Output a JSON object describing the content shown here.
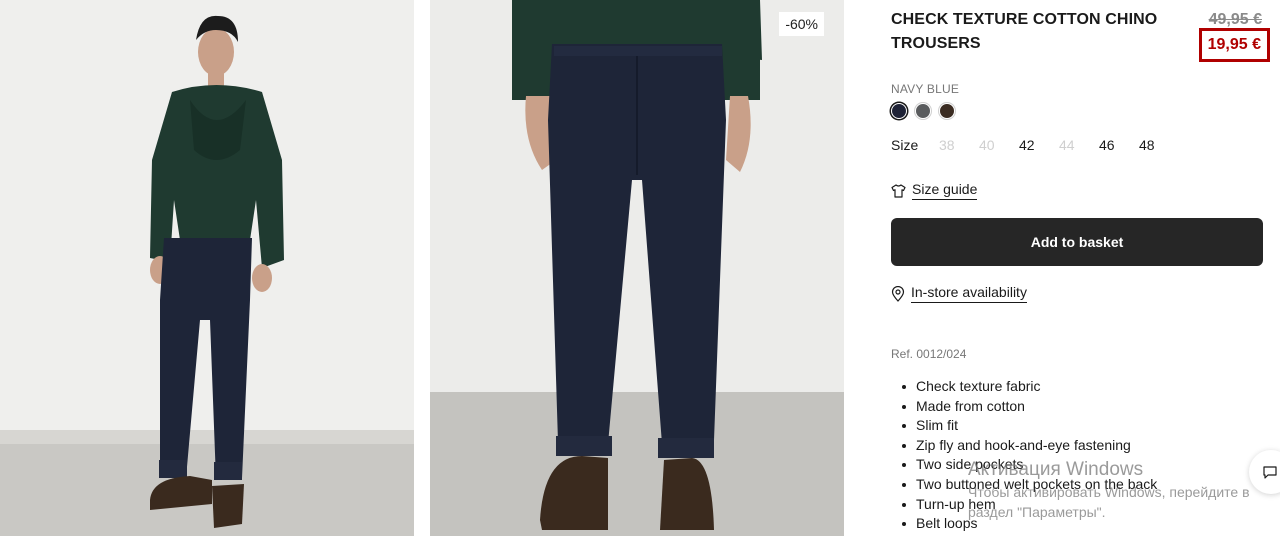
{
  "product": {
    "title": "CHECK TEXTURE COTTON CHINO TROUSERS",
    "old_price": "49,95 €",
    "new_price": "19,95 €",
    "discount_badge": "-60%",
    "color_name": "NAVY BLUE",
    "swatches": [
      {
        "name": "navy-blue",
        "color": "#1e2236",
        "selected": true
      },
      {
        "name": "grey",
        "color": "#5a5c5e",
        "selected": false
      },
      {
        "name": "brown",
        "color": "#3b2c22",
        "selected": false
      }
    ],
    "size_label": "Size",
    "sizes": [
      {
        "label": "38",
        "available": false
      },
      {
        "label": "40",
        "available": false
      },
      {
        "label": "42",
        "available": true
      },
      {
        "label": "44",
        "available": false
      },
      {
        "label": "46",
        "available": true
      },
      {
        "label": "48",
        "available": true
      }
    ],
    "size_guide_label": "Size guide",
    "add_to_basket_label": "Add to basket",
    "store_availability_label": "In-store availability",
    "ref": "Ref. 0012/024",
    "features": [
      "Check texture fabric",
      "Made from cotton",
      "Slim fit",
      "Zip fly and hook-and-eye fastening",
      "Two side pockets",
      "Two buttoned welt pockets on the back",
      "Turn-up hem",
      "Belt loops"
    ]
  },
  "watermark": {
    "title": "Активация Windows",
    "body": "Чтобы активировать Windows, перейдите в раздел \"Параметры\"."
  },
  "icons": {
    "size_guide": "tshirt-icon",
    "store": "location-pin-icon",
    "chat": "chat-bubble-icon"
  },
  "colors": {
    "sale_red": "#b00000",
    "button_dark": "#262626",
    "trousers_navy": "#1e2538",
    "sweater_green": "#1f3a30"
  }
}
